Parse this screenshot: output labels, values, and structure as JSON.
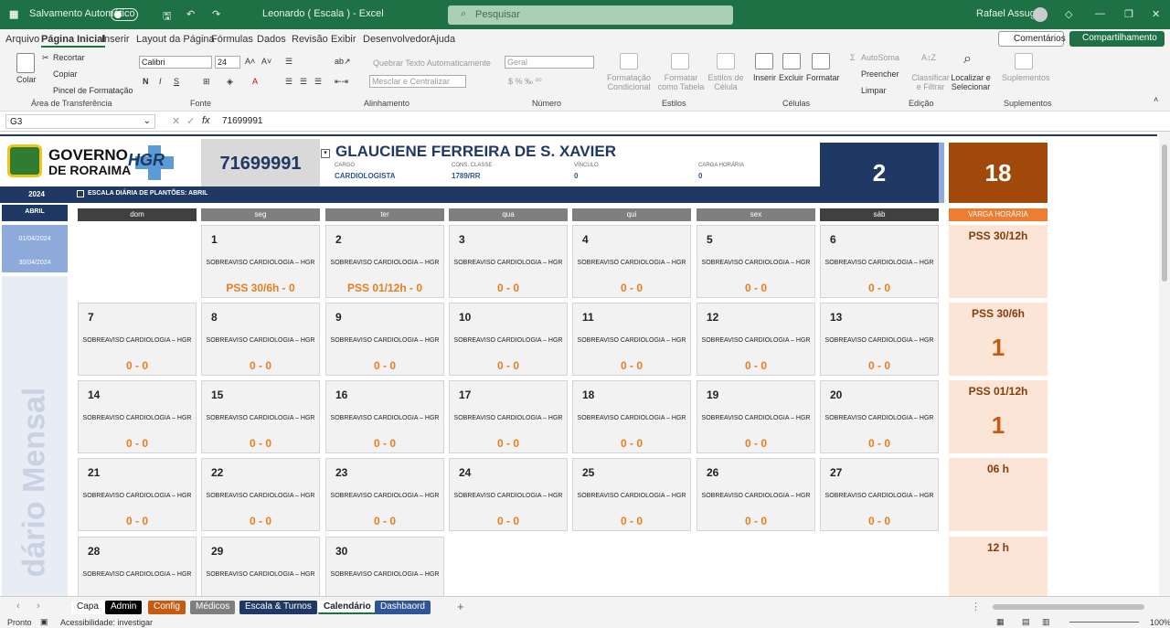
{
  "titlebar": {
    "autosave": "Salvamento Automático",
    "doc_title": "Leonardo ( Escala ) - Excel",
    "search_placeholder": "Pesquisar",
    "user": "Rafael Assuger"
  },
  "menu": [
    "Arquivo",
    "Página Inicial",
    "Inserir",
    "Layout da Página",
    "Fórmulas",
    "Dados",
    "Revisão",
    "Exibir",
    "Desenvolvedor",
    "Ajuda"
  ],
  "menu_right": {
    "comments": "Comentários",
    "share": "Compartilhamento"
  },
  "ribbon": {
    "paste": "Colar",
    "cut": "Recortar",
    "copy": "Copiar",
    "painter": "Pincel de Formatação",
    "group_clipboard": "Área de Transferência",
    "font_name": "Calibri",
    "font_size": "24",
    "group_font": "Fonte",
    "wrap": "Quebrar Texto Automaticamente",
    "merge": "Mesclar e Centralizar",
    "group_align": "Alinhamento",
    "number_format": "Geral",
    "group_number": "Número",
    "cond": "Formatação Condicional",
    "table": "Formatar como Tabela",
    "styles": "Estilos de Célula",
    "group_styles": "Estilos",
    "insert": "Inserir",
    "delete": "Excluir",
    "format": "Formatar",
    "group_cells": "Células",
    "autosum": "AutoSoma",
    "fill": "Preencher",
    "clear": "Limpar",
    "sort": "Classificar e Filtrar",
    "find": "Localizar e Selecionar",
    "group_edit": "Edição",
    "addins": "Suplementos",
    "group_addins": "Suplementos"
  },
  "formula_bar": {
    "cell": "G3",
    "value": "71699991"
  },
  "header": {
    "logo_line1": "GOVERNO",
    "logo_line2": "DE RORAIMA",
    "hgr": "HGR",
    "id": "71699991",
    "name": "GLAUCIENE FERREIRA DE S. XAVIER",
    "cargo_label": "CARGO",
    "cargo": "CARDIOLOGISTA",
    "classe_label": "CONS. CLASSE",
    "classe": "1789/RR",
    "vinculo_label": "VÍNCULO",
    "vinculo": "0",
    "carga_label": "CARGA HORÁRIA",
    "carga": "0",
    "count_blue": "2",
    "count_orange": "18"
  },
  "bar": {
    "year": "2024",
    "title": "ESCALA DIÁRIA DE PLANTÕES: ABRIL"
  },
  "left": {
    "month": "ABRIL",
    "start": "01/04/2024",
    "end": "30/04/2024",
    "vertical": "dário Mensal"
  },
  "days": [
    "dom",
    "seg",
    "ter",
    "qua",
    "qui",
    "sex",
    "sáb"
  ],
  "right_header": "VARGA HORÁRIA",
  "calendar": [
    {
      "d": "1",
      "t": "SOBREAVISO CARDIOLOGIA – HGR",
      "v": "PSS 30/6h - 0"
    },
    {
      "d": "2",
      "t": "SOBREAVISO CARDIOLOGIA – HGR",
      "v": "PSS 01/12h - 0"
    },
    {
      "d": "3",
      "t": "SOBREAVISO CARDIOLOGIA – HGR",
      "v": "0 - 0"
    },
    {
      "d": "4",
      "t": "SOBREAVISO CARDIOLOGIA – HGR",
      "v": "0 - 0"
    },
    {
      "d": "5",
      "t": "SOBREAVISO CARDIOLOGIA – HGR",
      "v": "0 - 0"
    },
    {
      "d": "6",
      "t": "SOBREAVISO CARDIOLOGIA – HGR",
      "v": "0 - 0"
    },
    {
      "d": "7",
      "t": "SOBREAVISO CARDIOLOGIA – HGR",
      "v": "0 - 0"
    },
    {
      "d": "8",
      "t": "SOBREAVISO CARDIOLOGIA – HGR",
      "v": "0 - 0"
    },
    {
      "d": "9",
      "t": "SOBREAVISO CARDIOLOGIA – HGR",
      "v": "0 - 0"
    },
    {
      "d": "10",
      "t": "SOBREAVISO CARDIOLOGIA – HGR",
      "v": "0 - 0"
    },
    {
      "d": "11",
      "t": "SOBREAVISO CARDIOLOGIA – HGR",
      "v": "0 - 0"
    },
    {
      "d": "12",
      "t": "SOBREAVISO CARDIOLOGIA – HGR",
      "v": "0 - 0"
    },
    {
      "d": "13",
      "t": "SOBREAVISO CARDIOLOGIA – HGR",
      "v": "0 - 0"
    },
    {
      "d": "14",
      "t": "SOBREAVISO CARDIOLOGIA – HGR",
      "v": "0 - 0"
    },
    {
      "d": "15",
      "t": "SOBREAVISO CARDIOLOGIA – HGR",
      "v": "0 - 0"
    },
    {
      "d": "16",
      "t": "SOBREAVISO CARDIOLOGIA – HGR",
      "v": "0 - 0"
    },
    {
      "d": "17",
      "t": "SOBREAVISO CARDIOLOGIA – HGR",
      "v": "0 - 0"
    },
    {
      "d": "18",
      "t": "SOBREAVISO CARDIOLOGIA – HGR",
      "v": "0 - 0"
    },
    {
      "d": "19",
      "t": "SOBREAVISO CARDIOLOGIA – HGR",
      "v": "0 - 0"
    },
    {
      "d": "20",
      "t": "SOBREAVISO CARDIOLOGIA – HGR",
      "v": "0 - 0"
    },
    {
      "d": "21",
      "t": "SOBREAVISO CARDIOLOGIA – HGR",
      "v": "0 - 0"
    },
    {
      "d": "22",
      "t": "SOBREAVISO CARDIOLOGIA – HGR",
      "v": "0 - 0"
    },
    {
      "d": "23",
      "t": "SOBREAVISO CARDIOLOGIA – HGR",
      "v": "0 - 0"
    },
    {
      "d": "24",
      "t": "SOBREAVISO CARDIOLOGIA – HGR",
      "v": "0 - 0"
    },
    {
      "d": "25",
      "t": "SOBREAVISO CARDIOLOGIA – HGR",
      "v": "0 - 0"
    },
    {
      "d": "26",
      "t": "SOBREAVISO CARDIOLOGIA – HGR",
      "v": "0 - 0"
    },
    {
      "d": "27",
      "t": "SOBREAVISO CARDIOLOGIA – HGR",
      "v": "0 - 0"
    },
    {
      "d": "28",
      "t": "SOBREAVISO CARDIOLOGIA – HGR",
      "v": ""
    },
    {
      "d": "29",
      "t": "SOBREAVISO CARDIOLOGIA – HGR",
      "v": ""
    },
    {
      "d": "30",
      "t": "SOBREAVISO CARDIOLOGIA – HGR",
      "v": ""
    }
  ],
  "right_cards": [
    {
      "label": "PSS 30/12h",
      "value": ""
    },
    {
      "label": "PSS 30/6h",
      "value": "1"
    },
    {
      "label": "PSS 01/12h",
      "value": "1"
    },
    {
      "label": "06 h",
      "value": ""
    },
    {
      "label": "12 h",
      "value": ""
    }
  ],
  "tabs": [
    {
      "label": "Capa",
      "bg": "#ffffff",
      "fg": "#222222"
    },
    {
      "label": "Admin",
      "bg": "#000000",
      "fg": "#ffffff"
    },
    {
      "label": "Config",
      "bg": "#c55a11",
      "fg": "#ffffff"
    },
    {
      "label": "Médicos",
      "bg": "#7f7f7f",
      "fg": "#ffffff"
    },
    {
      "label": "Escala & Turnos",
      "bg": "#1f3864",
      "fg": "#ffffff"
    },
    {
      "label": "Calendário",
      "bg": "#ffffff",
      "fg": "#222222"
    },
    {
      "label": "Dashbaord",
      "bg": "#2f5597",
      "fg": "#ffffff"
    }
  ],
  "status": {
    "ready": "Pronto",
    "access": "Acessibilidade: investigar",
    "zoom": "100%"
  }
}
